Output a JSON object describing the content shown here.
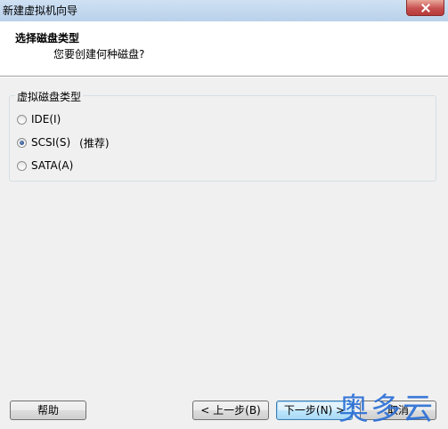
{
  "window": {
    "title": "新建虚拟机向导"
  },
  "header": {
    "title": "选择磁盘类型",
    "subtitle": "您要创建何种磁盘?"
  },
  "disk_type_group": {
    "label": "虚拟磁盘类型",
    "options": [
      {
        "label": "IDE(I)",
        "checked": false
      },
      {
        "label": "SCSI(S)",
        "checked": true,
        "note": "(推荐)"
      },
      {
        "label": "SATA(A)",
        "checked": false
      }
    ]
  },
  "buttons": {
    "help": "帮助",
    "back": "< 上一步(B)",
    "next": "下一步(N) >",
    "cancel": "取消"
  },
  "watermark": {
    "text": "奥多云"
  }
}
